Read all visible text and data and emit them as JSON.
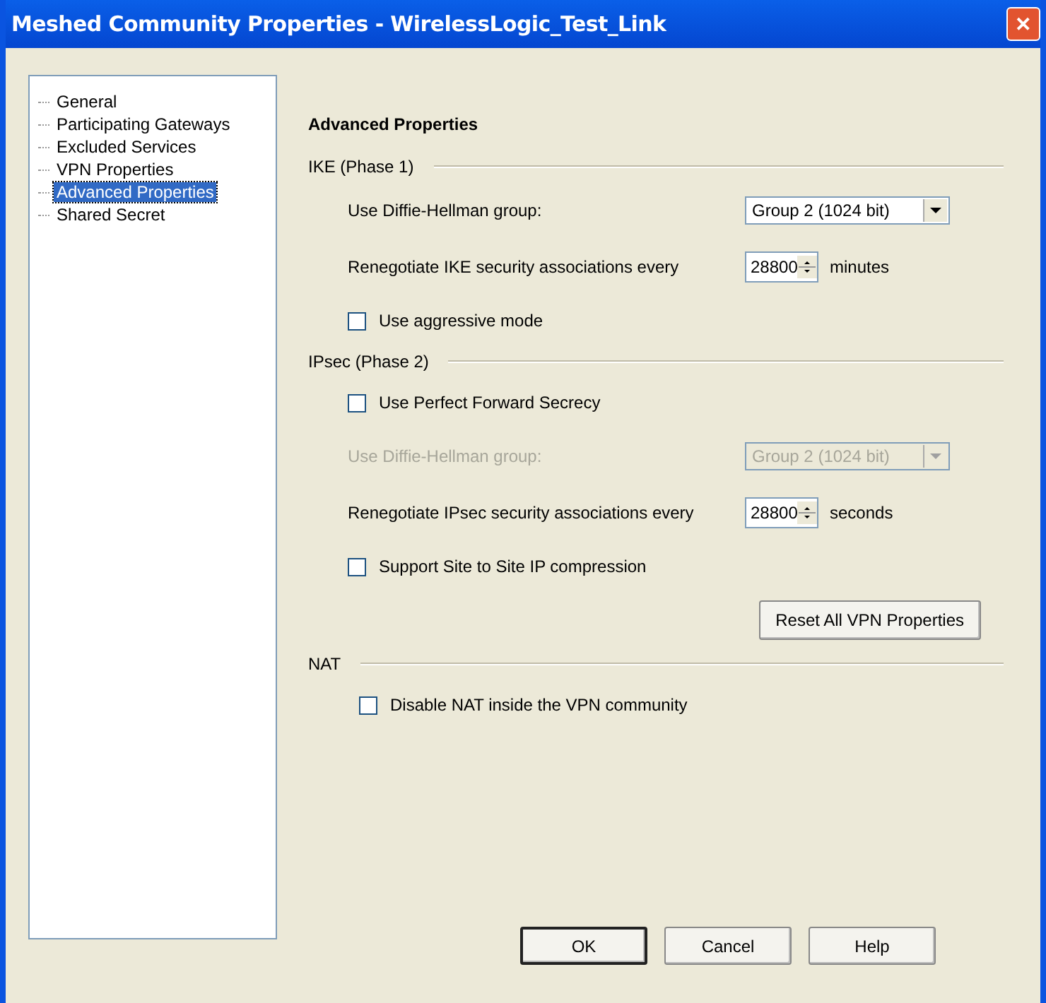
{
  "window": {
    "title": "Meshed Community Properties - WirelessLogic_Test_Link",
    "close": "✕"
  },
  "tree": [
    {
      "label": "General",
      "selected": false
    },
    {
      "label": "Participating Gateways",
      "selected": false
    },
    {
      "label": "Excluded Services",
      "selected": false
    },
    {
      "label": "VPN Properties",
      "selected": false
    },
    {
      "label": "Advanced Properties",
      "selected": true
    },
    {
      "label": "Shared Secret",
      "selected": false
    }
  ],
  "heading": "Advanced Properties",
  "sections": [
    {
      "title": "IKE (Phase 1)",
      "rows": [
        {
          "kind": "select",
          "label": "Use Diffie-Hellman group:",
          "value": "Group 2 (1024 bit)",
          "disabled": false
        },
        {
          "kind": "spin",
          "label": "Renegotiate IKE security associations every",
          "value": "28800",
          "unit": "minutes"
        },
        {
          "kind": "check",
          "label": "Use aggressive mode",
          "checked": false
        }
      ]
    },
    {
      "title": "IPsec (Phase 2)",
      "rows": [
        {
          "kind": "check",
          "label": "Use Perfect Forward Secrecy",
          "checked": false
        },
        {
          "kind": "select",
          "label": "Use Diffie-Hellman group:",
          "value": "Group 2 (1024 bit)",
          "disabled": true
        },
        {
          "kind": "spin",
          "label": "Renegotiate IPsec security associations every",
          "value": "28800",
          "unit": "seconds"
        },
        {
          "kind": "check",
          "label": "Support Site to Site IP compression",
          "checked": false
        },
        {
          "kind": "button",
          "label": "Reset All VPN Properties"
        }
      ]
    },
    {
      "title": "NAT",
      "rows": [
        {
          "kind": "check",
          "label": "Disable NAT inside the VPN community",
          "checked": false
        }
      ]
    }
  ],
  "buttons": [
    {
      "label": "OK",
      "default": true
    },
    {
      "label": "Cancel",
      "default": false
    },
    {
      "label": "Help",
      "default": false
    }
  ]
}
